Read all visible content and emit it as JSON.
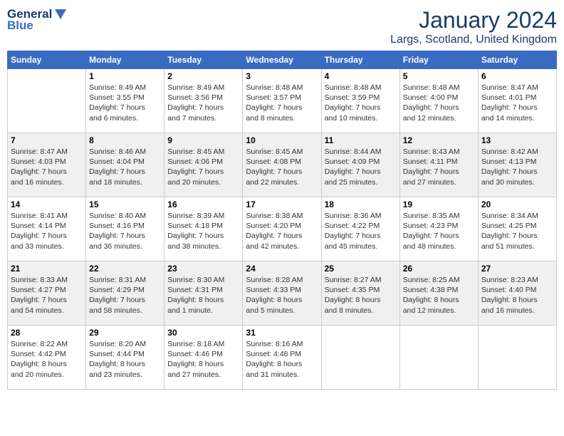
{
  "logo": {
    "line1": "General",
    "line2": "Blue"
  },
  "title": "January 2024",
  "location": "Largs, Scotland, United Kingdom",
  "days_header": [
    "Sunday",
    "Monday",
    "Tuesday",
    "Wednesday",
    "Thursday",
    "Friday",
    "Saturday"
  ],
  "weeks": [
    [
      {
        "day": "",
        "content": ""
      },
      {
        "day": "1",
        "content": "Sunrise: 8:49 AM\nSunset: 3:55 PM\nDaylight: 7 hours\nand 6 minutes."
      },
      {
        "day": "2",
        "content": "Sunrise: 8:49 AM\nSunset: 3:56 PM\nDaylight: 7 hours\nand 7 minutes."
      },
      {
        "day": "3",
        "content": "Sunrise: 8:48 AM\nSunset: 3:57 PM\nDaylight: 7 hours\nand 8 minutes."
      },
      {
        "day": "4",
        "content": "Sunrise: 8:48 AM\nSunset: 3:59 PM\nDaylight: 7 hours\nand 10 minutes."
      },
      {
        "day": "5",
        "content": "Sunrise: 8:48 AM\nSunset: 4:00 PM\nDaylight: 7 hours\nand 12 minutes."
      },
      {
        "day": "6",
        "content": "Sunrise: 8:47 AM\nSunset: 4:01 PM\nDaylight: 7 hours\nand 14 minutes."
      }
    ],
    [
      {
        "day": "7",
        "content": "Sunrise: 8:47 AM\nSunset: 4:03 PM\nDaylight: 7 hours\nand 16 minutes."
      },
      {
        "day": "8",
        "content": "Sunrise: 8:46 AM\nSunset: 4:04 PM\nDaylight: 7 hours\nand 18 minutes."
      },
      {
        "day": "9",
        "content": "Sunrise: 8:45 AM\nSunset: 4:06 PM\nDaylight: 7 hours\nand 20 minutes."
      },
      {
        "day": "10",
        "content": "Sunrise: 8:45 AM\nSunset: 4:08 PM\nDaylight: 7 hours\nand 22 minutes."
      },
      {
        "day": "11",
        "content": "Sunrise: 8:44 AM\nSunset: 4:09 PM\nDaylight: 7 hours\nand 25 minutes."
      },
      {
        "day": "12",
        "content": "Sunrise: 8:43 AM\nSunset: 4:11 PM\nDaylight: 7 hours\nand 27 minutes."
      },
      {
        "day": "13",
        "content": "Sunrise: 8:42 AM\nSunset: 4:13 PM\nDaylight: 7 hours\nand 30 minutes."
      }
    ],
    [
      {
        "day": "14",
        "content": "Sunrise: 8:41 AM\nSunset: 4:14 PM\nDaylight: 7 hours\nand 33 minutes."
      },
      {
        "day": "15",
        "content": "Sunrise: 8:40 AM\nSunset: 4:16 PM\nDaylight: 7 hours\nand 36 minutes."
      },
      {
        "day": "16",
        "content": "Sunrise: 8:39 AM\nSunset: 4:18 PM\nDaylight: 7 hours\nand 38 minutes."
      },
      {
        "day": "17",
        "content": "Sunrise: 8:38 AM\nSunset: 4:20 PM\nDaylight: 7 hours\nand 42 minutes."
      },
      {
        "day": "18",
        "content": "Sunrise: 8:36 AM\nSunset: 4:22 PM\nDaylight: 7 hours\nand 45 minutes."
      },
      {
        "day": "19",
        "content": "Sunrise: 8:35 AM\nSunset: 4:23 PM\nDaylight: 7 hours\nand 48 minutes."
      },
      {
        "day": "20",
        "content": "Sunrise: 8:34 AM\nSunset: 4:25 PM\nDaylight: 7 hours\nand 51 minutes."
      }
    ],
    [
      {
        "day": "21",
        "content": "Sunrise: 8:33 AM\nSunset: 4:27 PM\nDaylight: 7 hours\nand 54 minutes."
      },
      {
        "day": "22",
        "content": "Sunrise: 8:31 AM\nSunset: 4:29 PM\nDaylight: 7 hours\nand 58 minutes."
      },
      {
        "day": "23",
        "content": "Sunrise: 8:30 AM\nSunset: 4:31 PM\nDaylight: 8 hours\nand 1 minute."
      },
      {
        "day": "24",
        "content": "Sunrise: 8:28 AM\nSunset: 4:33 PM\nDaylight: 8 hours\nand 5 minutes."
      },
      {
        "day": "25",
        "content": "Sunrise: 8:27 AM\nSunset: 4:35 PM\nDaylight: 8 hours\nand 8 minutes."
      },
      {
        "day": "26",
        "content": "Sunrise: 8:25 AM\nSunset: 4:38 PM\nDaylight: 8 hours\nand 12 minutes."
      },
      {
        "day": "27",
        "content": "Sunrise: 8:23 AM\nSunset: 4:40 PM\nDaylight: 8 hours\nand 16 minutes."
      }
    ],
    [
      {
        "day": "28",
        "content": "Sunrise: 8:22 AM\nSunset: 4:42 PM\nDaylight: 8 hours\nand 20 minutes."
      },
      {
        "day": "29",
        "content": "Sunrise: 8:20 AM\nSunset: 4:44 PM\nDaylight: 8 hours\nand 23 minutes."
      },
      {
        "day": "30",
        "content": "Sunrise: 8:18 AM\nSunset: 4:46 PM\nDaylight: 8 hours\nand 27 minutes."
      },
      {
        "day": "31",
        "content": "Sunrise: 8:16 AM\nSunset: 4:48 PM\nDaylight: 8 hours\nand 31 minutes."
      },
      {
        "day": "",
        "content": ""
      },
      {
        "day": "",
        "content": ""
      },
      {
        "day": "",
        "content": ""
      }
    ]
  ]
}
